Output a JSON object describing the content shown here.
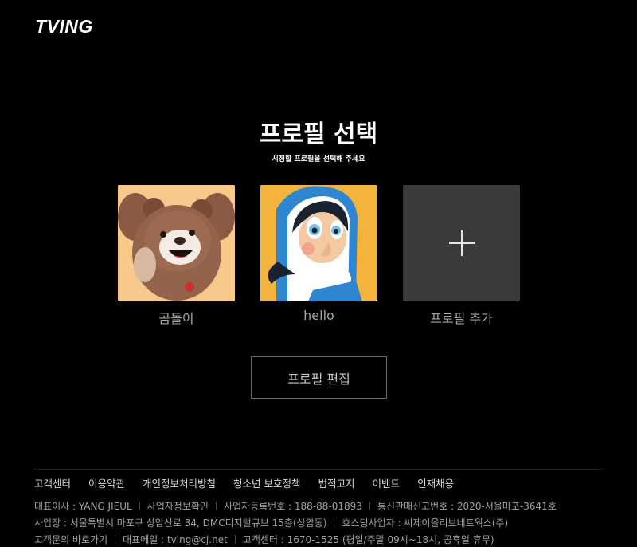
{
  "brand": {
    "logo": "TVING"
  },
  "header": {
    "title": "프로필 선택",
    "subtitle": "시청할 프로필을 선택해 주세요"
  },
  "profiles": [
    {
      "name": "곰돌이",
      "avatar": "bear-avatar"
    },
    {
      "name": "hello",
      "avatar": "hooded-girl-avatar"
    },
    {
      "name": "프로필 추가",
      "icon": "plus-icon"
    }
  ],
  "actions": {
    "edit_label": "프로필 편집"
  },
  "footer": {
    "links": [
      "고객센터",
      "이용약관",
      "개인정보처리방침",
      "청소년 보호정책",
      "법적고지",
      "이벤트",
      "인재채용"
    ],
    "line1": [
      "대표이사 : YANG JIEUL",
      "사업자정보확인",
      "사업자등록번호 : 188-88-01893",
      "통신판매신고번호 : 2020-서울마포-3641호"
    ],
    "line2": [
      "사업장 : 서울특별시 마포구 상암산로 34, DMC디지털큐브 15층(상암동)",
      "호스팅사업자 : 씨제이올리브네트웍스(주)"
    ],
    "line3": [
      "고객문의 바로가기",
      "대표메일 : tving@cj.net",
      "고객센터 : 1670-1525 (평일/주말 09시~18시, 공휴일 휴무)"
    ]
  },
  "colors": {
    "background": "#000000",
    "add_tile": "#3a3a3c",
    "bear_bg": "#f6c98a",
    "hood_bg": "#f4b43c"
  }
}
